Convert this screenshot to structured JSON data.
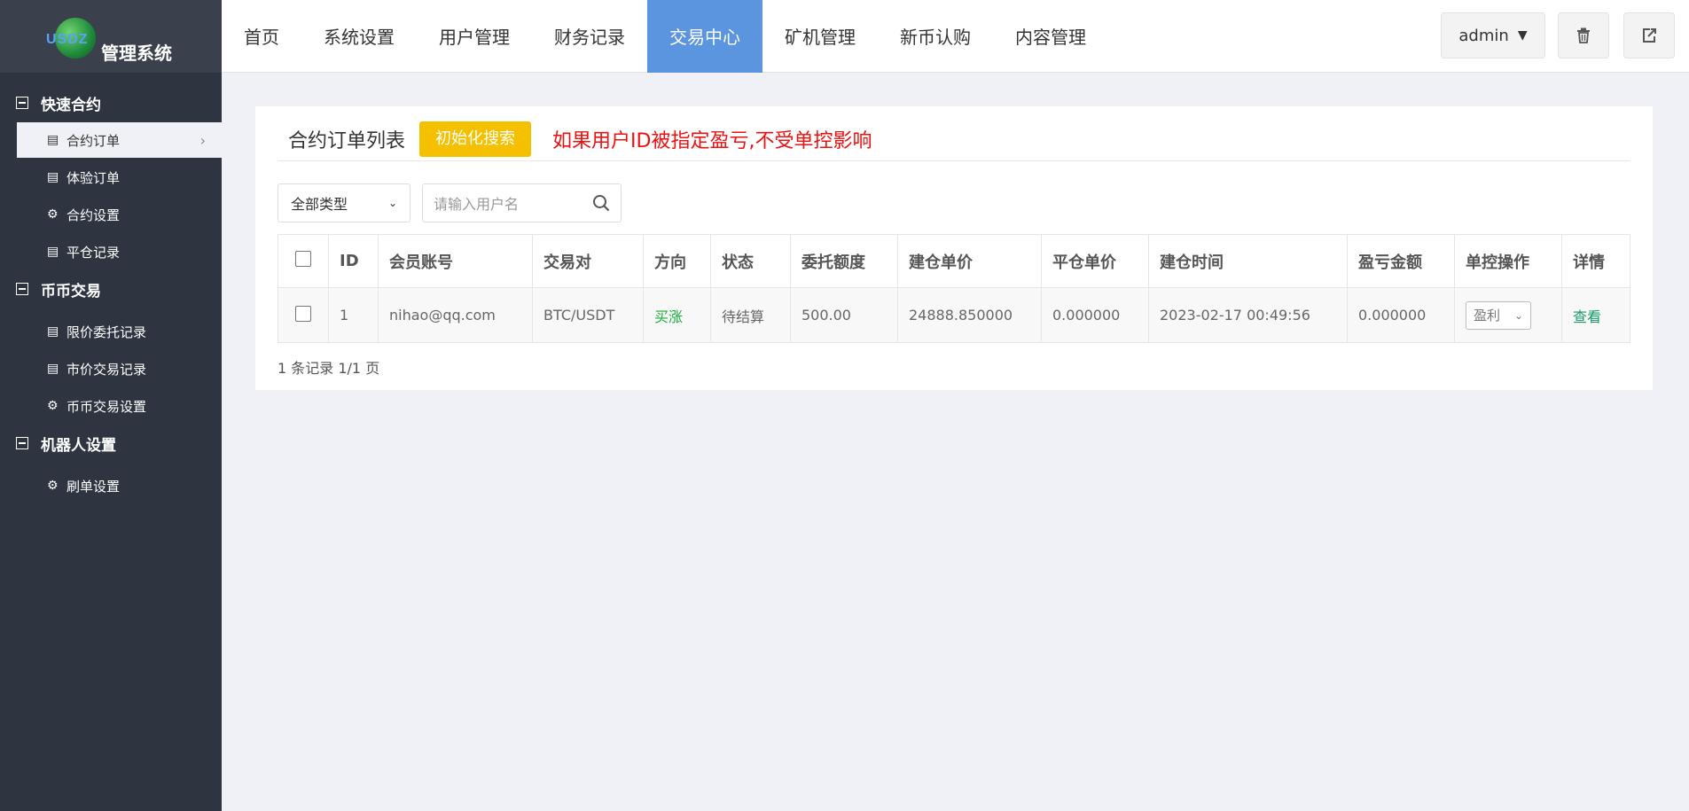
{
  "logo": {
    "badge": "USDZ",
    "title": "管理系统"
  },
  "topnav": {
    "tabs": [
      "首页",
      "系统设置",
      "用户管理",
      "财务记录",
      "交易中心",
      "矿机管理",
      "新币认购",
      "内容管理"
    ],
    "active_index": 4,
    "user": "admin"
  },
  "sidebar": {
    "groups": [
      {
        "title": "快速合约",
        "items": [
          {
            "label": "合约订单",
            "icon": "table-icon",
            "active": true
          },
          {
            "label": "体验订单",
            "icon": "table-icon"
          },
          {
            "label": "合约设置",
            "icon": "gear-icon"
          },
          {
            "label": "平仓记录",
            "icon": "table-icon"
          }
        ]
      },
      {
        "title": "币币交易",
        "items": [
          {
            "label": "限价委托记录",
            "icon": "table-icon"
          },
          {
            "label": "市价交易记录",
            "icon": "table-icon"
          },
          {
            "label": "币币交易设置",
            "icon": "gear-icon"
          }
        ]
      },
      {
        "title": "机器人设置",
        "items": [
          {
            "label": "刷单设置",
            "icon": "gear-icon"
          }
        ]
      }
    ]
  },
  "main": {
    "title": "合约订单列表",
    "init_button": "初始化搜索",
    "warning": "如果用户ID被指定盈亏,不受单控影响",
    "filter_type": "全部类型",
    "search_placeholder": "请输入用户名",
    "columns": [
      "ID",
      "会员账号",
      "交易对",
      "方向",
      "状态",
      "委托额度",
      "建仓单价",
      "平仓单价",
      "建仓时间",
      "盈亏金额",
      "单控操作",
      "详情"
    ],
    "rows": [
      {
        "id": "1",
        "account": "nihao@qq.com",
        "pair": "BTC/USDT",
        "direction": "买涨",
        "status": "待结算",
        "amount": "500.00",
        "open_price": "24888.850000",
        "close_price": "0.000000",
        "open_time": "2023-02-17 00:49:56",
        "pnl": "0.000000",
        "control": "盈利",
        "detail": "查看"
      }
    ],
    "pager": "1 条记录 1/1 页"
  },
  "colors": {
    "sidebar_bg": "#2e3440",
    "accent": "#5b95e0",
    "warning": "#ee1111",
    "init_button": "#f5c000"
  }
}
